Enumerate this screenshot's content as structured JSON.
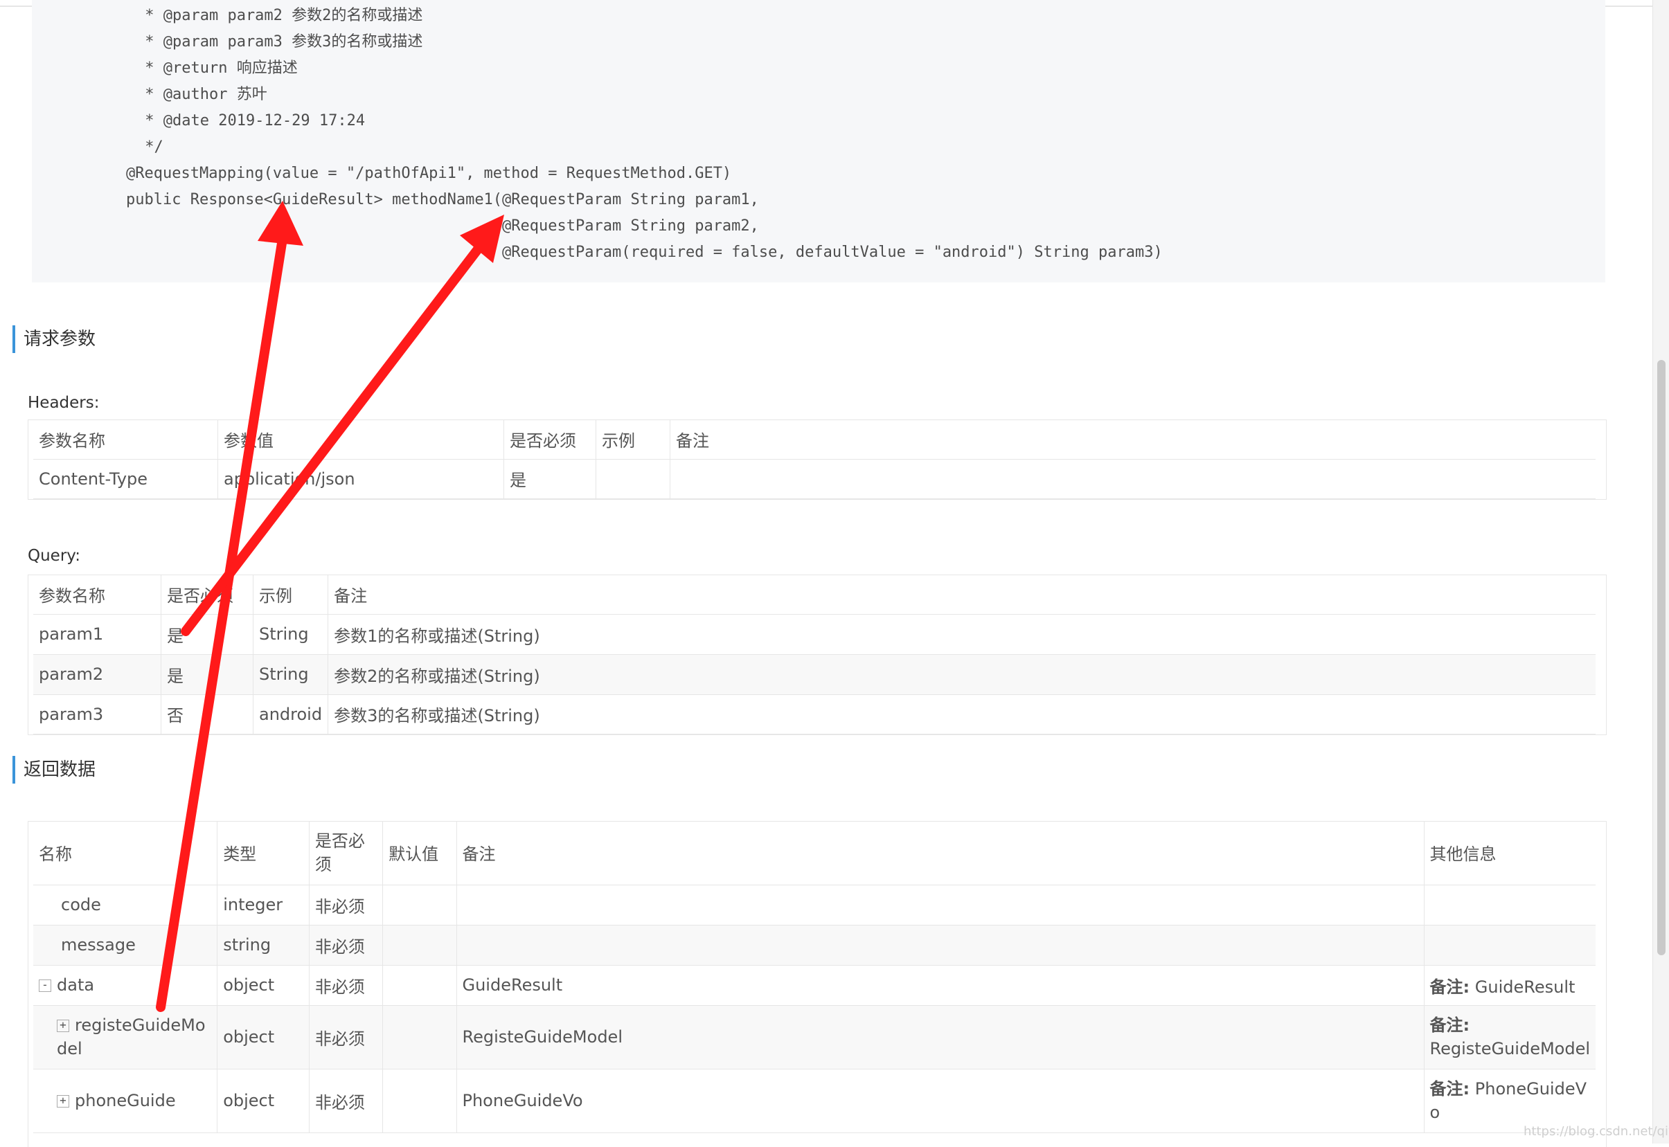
{
  "code": {
    "lines": [
      " * @param param2 参数2的名称或描述",
      " * @param param3 参数3的名称或描述",
      " * @return 响应描述",
      " * @author 苏叶",
      " * @date 2019-12-29 17:24",
      " */",
      "@RequestMapping(value = \"/pathOfApi1\", method = RequestMethod.GET)",
      "public Response<GuideResult> methodName1(@RequestParam String param1,",
      "                                         @RequestParam String param2,",
      "                                         @RequestParam(required = false, defaultValue = \"android\") String param3)"
    ]
  },
  "request_params": {
    "title": "请求参数",
    "headers_label": "Headers:",
    "headers_table": {
      "columns": [
        "参数名称",
        "参数值",
        "是否必须",
        "示例",
        "备注"
      ],
      "rows": [
        [
          "Content-Type",
          "application/json",
          "是",
          "",
          ""
        ]
      ]
    },
    "query_label": "Query:",
    "query_table": {
      "columns": [
        "参数名称",
        "是否必须",
        "示例",
        "备注"
      ],
      "rows": [
        [
          "param1",
          "是",
          "String",
          "参数1的名称或描述(String)"
        ],
        [
          "param2",
          "是",
          "String",
          "参数2的名称或描述(String)"
        ],
        [
          "param3",
          "否",
          "android",
          "参数3的名称或描述(String)"
        ]
      ]
    }
  },
  "response": {
    "title": "返回数据",
    "columns": [
      "名称",
      "类型",
      "是否必须",
      "默认值",
      "备注",
      "其他信息"
    ],
    "rows": [
      {
        "name": "code",
        "type": "integer",
        "required": "非必须",
        "default": "",
        "note": "",
        "other_key": "",
        "other_val": "",
        "toggle": ""
      },
      {
        "name": "message",
        "type": "string",
        "required": "非必须",
        "default": "",
        "note": "",
        "other_key": "",
        "other_val": "",
        "toggle": ""
      },
      {
        "name": "data",
        "type": "object",
        "required": "非必须",
        "default": "",
        "note": "GuideResult",
        "other_key": "备注:",
        "other_val": " GuideResult",
        "toggle": "-"
      },
      {
        "name": "registeGuideModel",
        "type": "object",
        "required": "非必须",
        "default": "",
        "note": "RegisteGuideModel",
        "other_key": "备注:",
        "other_val": " RegisteGuideModel",
        "toggle": "+"
      },
      {
        "name": "phoneGuide",
        "type": "object",
        "required": "非必须",
        "default": "",
        "note": "PhoneGuideVo",
        "other_key": "备注:",
        "other_val": " PhoneGuideVo",
        "toggle": "+"
      }
    ]
  },
  "colors": {
    "accent": "#3b94d9",
    "arrow": "#ff1a1a"
  },
  "watermark": "https://blog.csdn.net/qiyuhui"
}
